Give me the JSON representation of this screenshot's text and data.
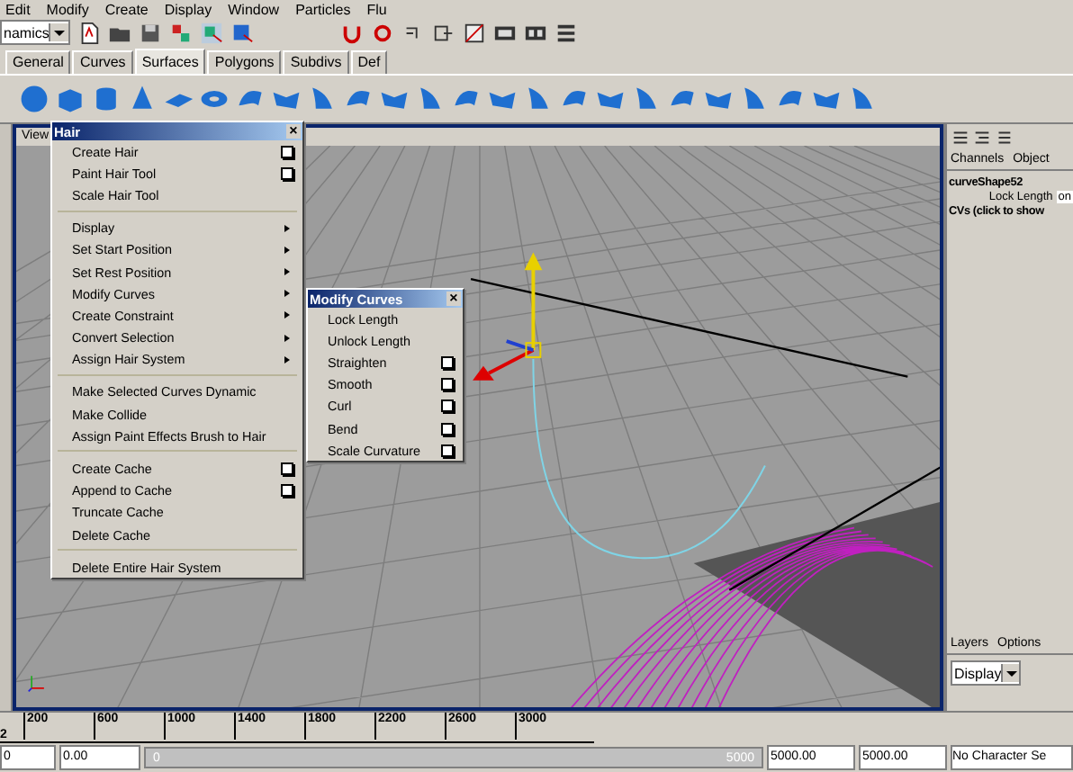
{
  "menu_bar": [
    "Edit",
    "Modify",
    "Create",
    "Display",
    "Window",
    "Particles",
    "Flu"
  ],
  "toolbar": {
    "mode_dropdown": "namics"
  },
  "shelf_tabs": [
    {
      "label": "General",
      "selected": false
    },
    {
      "label": "Curves",
      "selected": false
    },
    {
      "label": "Surfaces",
      "selected": true
    },
    {
      "label": "Polygons",
      "selected": false
    },
    {
      "label": "Subdivs",
      "selected": false
    },
    {
      "label": "Def",
      "selected": false
    }
  ],
  "viewport": {
    "menu": [
      "View"
    ]
  },
  "hair_menu": {
    "title": "Hair",
    "close": "×",
    "items": [
      {
        "kind": "item",
        "label": "Create Hair",
        "option_box": true
      },
      {
        "kind": "item",
        "label": "Paint Hair Tool",
        "option_box": true
      },
      {
        "kind": "item",
        "label": "Scale Hair Tool",
        "option_box": false
      },
      {
        "kind": "divider"
      },
      {
        "kind": "submenu",
        "label": "Display",
        "option_box": false
      },
      {
        "kind": "submenu",
        "label": "Set Start Position",
        "option_box": false
      },
      {
        "kind": "submenu",
        "label": "Set Rest Position",
        "option_box": false
      },
      {
        "kind": "submenu",
        "label": "Modify Curves",
        "option_box": false
      },
      {
        "kind": "submenu",
        "label": "Create Constraint",
        "option_box": false
      },
      {
        "kind": "submenu",
        "label": "Convert Selection",
        "option_box": false
      },
      {
        "kind": "submenu",
        "label": "Assign Hair System",
        "option_box": false
      },
      {
        "kind": "divider"
      },
      {
        "kind": "item",
        "label": "Make Selected Curves Dynamic",
        "option_box": false
      },
      {
        "kind": "item",
        "label": "Make Collide",
        "option_box": false
      },
      {
        "kind": "item",
        "label": "Assign Paint Effects Brush to Hair",
        "option_box": false
      },
      {
        "kind": "divider"
      },
      {
        "kind": "item",
        "label": "Create Cache",
        "option_box": true
      },
      {
        "kind": "item",
        "label": "Append to Cache",
        "option_box": true
      },
      {
        "kind": "item",
        "label": "Truncate Cache",
        "option_box": false
      },
      {
        "kind": "item",
        "label": "Delete Cache",
        "option_box": false
      },
      {
        "kind": "divider"
      },
      {
        "kind": "item",
        "label": "Delete Entire Hair System",
        "option_box": false
      }
    ]
  },
  "modify_curves_menu": {
    "title": "Modify Curves",
    "close": "×",
    "items": [
      {
        "kind": "item",
        "label": "Lock Length",
        "option_box": false
      },
      {
        "kind": "item",
        "label": "Unlock Length",
        "option_box": false
      },
      {
        "kind": "item",
        "label": "Straighten",
        "option_box": true
      },
      {
        "kind": "item",
        "label": "Smooth",
        "option_box": true
      },
      {
        "kind": "item",
        "label": "Curl",
        "option_box": true
      },
      {
        "kind": "item",
        "label": "Bend",
        "option_box": true
      },
      {
        "kind": "item",
        "label": "Scale Curvature",
        "option_box": true
      }
    ]
  },
  "channel_box": {
    "tabs": [
      "Channels",
      "Object"
    ],
    "node": "curveShape52",
    "attributes": [
      {
        "name": "Lock Length",
        "value": "on"
      }
    ],
    "section": "CVs (click to show"
  },
  "layer_editor": {
    "tabs": [
      "Layers",
      "Options"
    ],
    "dropdown": "Display"
  },
  "time_slider": {
    "ticks": [
      "200",
      "600",
      "1000",
      "1400",
      "1800",
      "2200",
      "2600",
      "3000"
    ],
    "start_label": "2"
  },
  "range_slider": {
    "start_field": "0",
    "start_time": "0.00",
    "bar_start": "0",
    "bar_end": "5000",
    "end_time": "5000.00",
    "end_field": "5000.00",
    "character_set": "No Character Se"
  }
}
